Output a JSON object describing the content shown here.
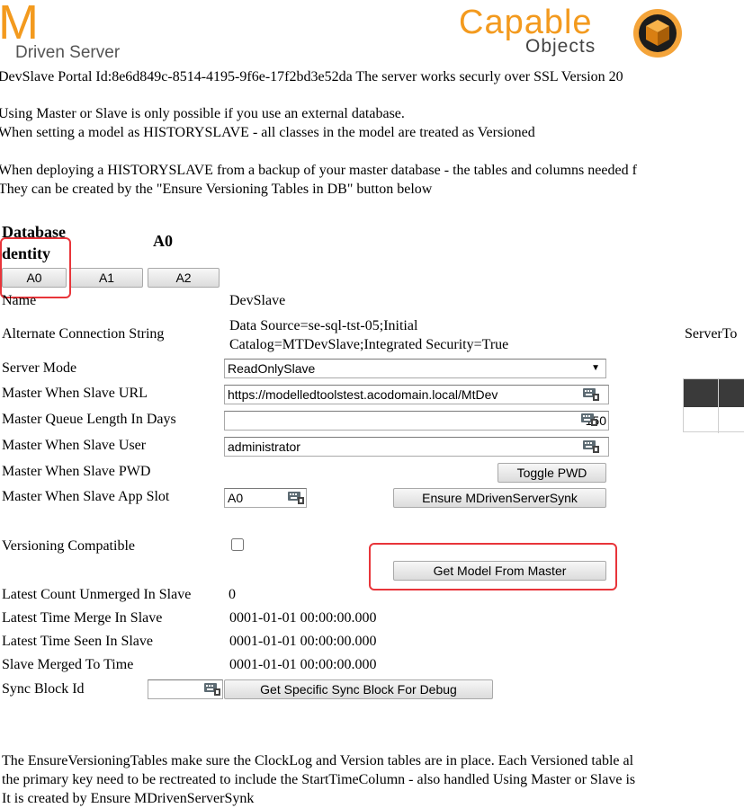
{
  "header": {
    "m_logo_letter": "M",
    "m_logo_text": "Driven Server",
    "capable_line1": "Capable",
    "capable_line2": "Objects"
  },
  "portal_line": "DevSlave  Portal Id:8e6d849c-8514-4195-9f6e-17f2bd3e52da  The server works securly over SSL Version 20",
  "intro": {
    "line1": "Using Master or Slave is only possible if you use an external database.",
    "line2": "When setting a model as HISTORYSLAVE - all classes in the model are treated as Versioned",
    "line3": "When deploying a HISTORYSLAVE from a backup of your master database - the tables and columns needed f",
    "line4": "They can be created by the \"Ensure Versioning Tables in DB\" button below"
  },
  "database_identity": {
    "heading_line1": "Database",
    "heading_line2": "dentity",
    "current_value": "A0",
    "slot_buttons": [
      "A0",
      "A1",
      "A2"
    ]
  },
  "fields": {
    "name_label": "Name",
    "name_value": "DevSlave",
    "alt_conn_label": "Alternate Connection String",
    "alt_conn_value_line1": "Data Source=se-sql-tst-05;Initial",
    "alt_conn_value_line2": "Catalog=MTDevSlave;Integrated Security=True",
    "server_mode_label": "Server Mode",
    "server_mode_value": "ReadOnlySlave",
    "master_url_label": "Master When Slave URL",
    "master_url_value": "https://modelledtoolstest.acodomain.local/MtDev",
    "queue_length_label": "Master Queue Length In Days",
    "queue_length_value": "150",
    "slave_user_label": "Master When Slave User",
    "slave_user_value": "administrator",
    "slave_pwd_label": "Master When Slave PWD",
    "toggle_pwd_label": "Toggle PWD",
    "app_slot_label": "Master When Slave App Slot",
    "app_slot_value": "A0",
    "ensure_synk_label": "Ensure MDrivenServerSynk",
    "versioning_label": "Versioning Compatible",
    "versioning_checked": false,
    "get_model_label": "Get Model From Master",
    "unmerged_label": "Latest Count Unmerged In Slave",
    "unmerged_value": "0",
    "merge_time_label": "Latest Time Merge In Slave",
    "merge_time_value": "0001-01-01 00:00:00.000",
    "seen_time_label": "Latest Time Seen In Slave",
    "seen_time_value": "0001-01-01 00:00:00.000",
    "merged_to_label": "Slave Merged To Time",
    "merged_to_value": "0001-01-01 00:00:00.000",
    "sync_block_label": "Sync Block Id",
    "sync_block_value": "",
    "get_sync_block_label": "Get Specific Sync Block For Debug"
  },
  "right_panel": {
    "label": "ServerTo"
  },
  "footer": {
    "line1": "The EnsureVersioningTables make sure the ClockLog and Version tables are in place. Each Versioned table al",
    "line2": "the primary key need to be rectreated to include the StartTimeColumn - also handled Using Master or Slave is",
    "line3": "It is created by Ensure MDrivenServerSynk"
  },
  "icons": {
    "keyboard": "keyboard-icon",
    "dropdown": "dropdown-arrow-icon",
    "cube_logo": "capable-objects-cube-logo"
  },
  "colors": {
    "brand_orange": "#f39a1e",
    "highlight_red": "#e8353a",
    "grid_header": "#3a3a3a"
  }
}
